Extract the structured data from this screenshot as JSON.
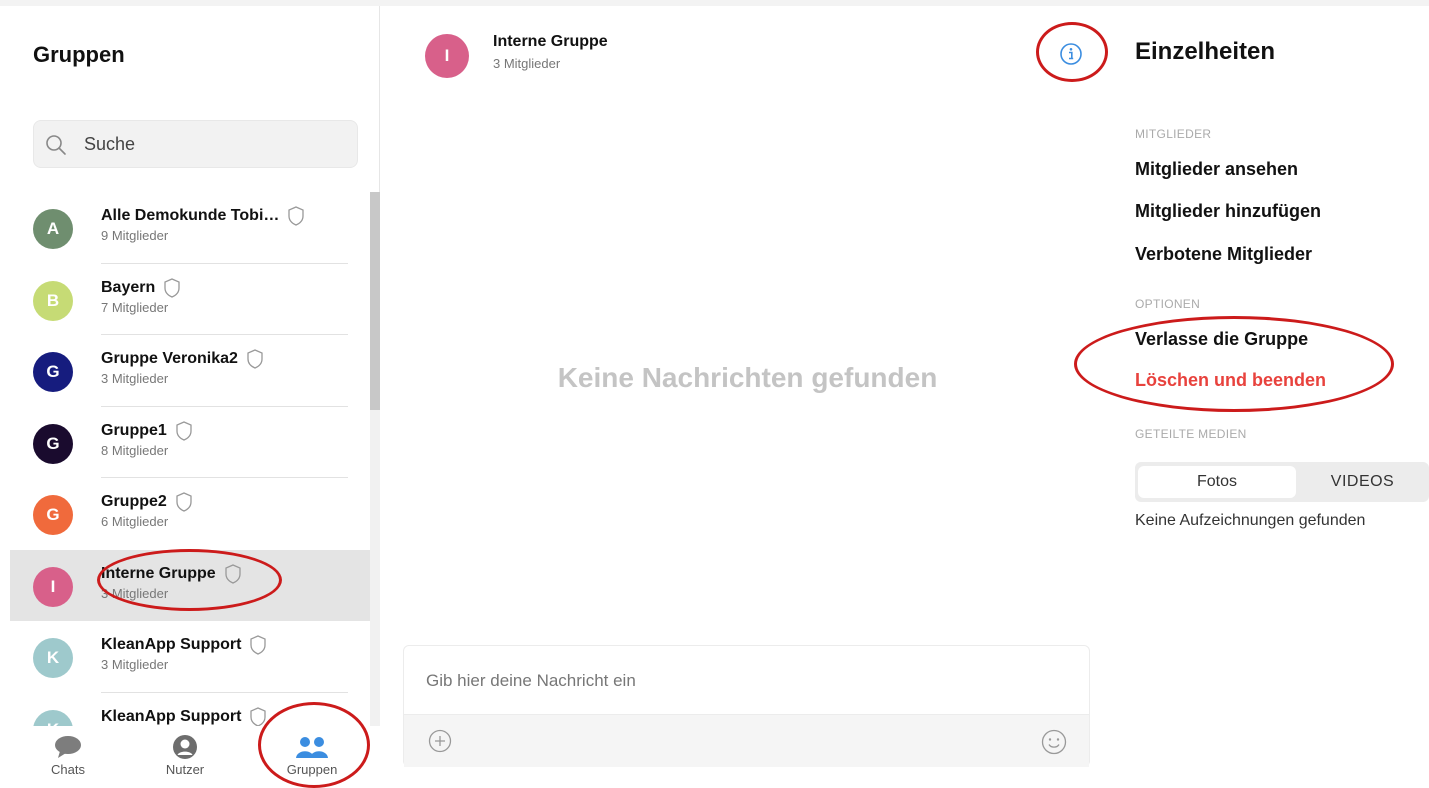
{
  "sidebar": {
    "title": "Gruppen",
    "search_placeholder": "Suche",
    "groups": [
      {
        "initial": "A",
        "name": "Alle Demokunde Tobi…",
        "members": "9 Mitglieder",
        "color": "#6f8e6f"
      },
      {
        "initial": "B",
        "name": "Bayern",
        "members": "7 Mitglieder",
        "color": "#c6db75"
      },
      {
        "initial": "G",
        "name": "Gruppe Veronika2",
        "members": "3 Mitglieder",
        "color": "#161c7e"
      },
      {
        "initial": "G",
        "name": "Gruppe1",
        "members": "8 Mitglieder",
        "color": "#1a0b2e"
      },
      {
        "initial": "G",
        "name": "Gruppe2",
        "members": "6 Mitglieder",
        "color": "#f06a3c"
      },
      {
        "initial": "I",
        "name": "Interne Gruppe",
        "members": "3 Mitglieder",
        "color": "#d8608a"
      },
      {
        "initial": "K",
        "name": "KleanApp Support",
        "members": "3 Mitglieder",
        "color": "#9ec9cc"
      },
      {
        "initial": "K",
        "name": "KleanApp Support",
        "members": "",
        "color": "#9ec9cc"
      }
    ],
    "active_index": 5
  },
  "bottom_nav": {
    "chats": "Chats",
    "users": "Nutzer",
    "groups": "Gruppen",
    "active_color": "#3b8de0"
  },
  "chat": {
    "avatar_initial": "I",
    "title": "Interne Gruppe",
    "subtitle": "3 Mitglieder",
    "empty_text": "Keine Nachrichten gefunden",
    "input_placeholder": "Gib hier deine Nachricht ein"
  },
  "details": {
    "title": "Einzelheiten",
    "members_label": "MITGLIEDER",
    "view_members": "Mitglieder ansehen",
    "add_members": "Mitglieder hinzufügen",
    "banned_members": "Verbotene Mitglieder",
    "options_label": "OPTIONEN",
    "leave_group": "Verlasse die Gruppe",
    "delete_and_exit": "Löschen und beenden",
    "shared_media_label": "GETEILTE MEDIEN",
    "tab_photos": "Fotos",
    "tab_videos": "VIDEOS",
    "no_records": "Keine Aufzeichnungen gefunden",
    "danger_color": "#e8423d"
  },
  "annotation_color": "#cc1b1b"
}
